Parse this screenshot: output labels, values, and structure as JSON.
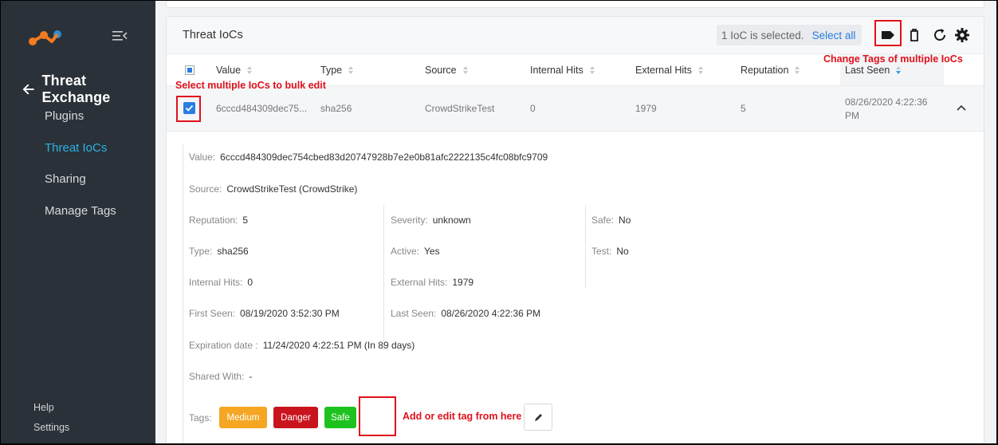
{
  "sidebar": {
    "back_label": "Threat Exchange",
    "items": [
      "Plugins",
      "Threat IoCs",
      "Sharing",
      "Manage Tags"
    ],
    "active_index": 1,
    "footer": [
      "Help",
      "Settings"
    ],
    "accent": "#2bb3e6"
  },
  "card": {
    "title": "Threat IoCs",
    "selection_text": "1 IoC is selected.",
    "select_all": "Select all",
    "icons": [
      "tag-icon",
      "trash-icon",
      "refresh-icon",
      "gear-icon"
    ]
  },
  "table": {
    "columns": [
      "Value",
      "Type",
      "Source",
      "Internal Hits",
      "External Hits",
      "Reputation",
      "Last Seen"
    ],
    "row": {
      "value": "6cccd484309dec75...",
      "type": "sha256",
      "source": "CrowdStrikeTest",
      "internal_hits": "0",
      "external_hits": "1979",
      "reputation": "5",
      "last_seen_1": "08/26/2020 4:22:36",
      "last_seen_2": "PM"
    }
  },
  "details": {
    "value_label": "Value:",
    "value": "6cccd484309dec754cbed83d20747928b7e2e0b81afc2222135c4fc08bfc9709",
    "source_label": "Source:",
    "source": "CrowdStrikeTest (CrowdStrike)",
    "reputation_label": "Reputation:",
    "reputation": "5",
    "severity_label": "Severity:",
    "severity": "unknown",
    "safe_label": "Safe:",
    "safe": "No",
    "type_label": "Type:",
    "type": "sha256",
    "active_label": "Active:",
    "active": "Yes",
    "test_label": "Test:",
    "test": "No",
    "internal_label": "Internal Hits:",
    "internal": "0",
    "external_label": "External Hits:",
    "external": "1979",
    "first_seen_label": "First Seen:",
    "first_seen": "08/19/2020 3:52:30 PM",
    "last_seen_label": "Last Seen:",
    "last_seen": "08/26/2020 4:22:36 PM",
    "expiration_label": "Expiration date :",
    "expiration": "11/24/2020 4:22:51 PM (In 89 days)",
    "shared_label": "Shared With:",
    "shared": "-",
    "tags_label": "Tags:",
    "tags": [
      {
        "label": "Medium",
        "color": "#f5a623"
      },
      {
        "label": "Danger",
        "color": "#c9141e"
      },
      {
        "label": "Safe",
        "color": "#1ec21e"
      }
    ]
  },
  "annotations": {
    "bulk_select": "Select multiple IoCs to bulk edit",
    "change_tags": "Change Tags of multiple IoCs",
    "add_edit_tag": "Add or edit tag from here",
    "color": "#e0121b"
  }
}
